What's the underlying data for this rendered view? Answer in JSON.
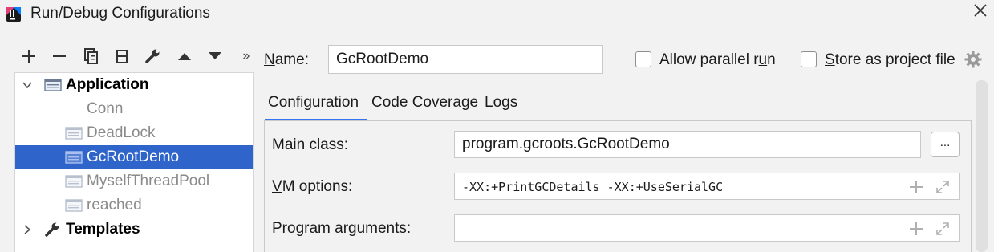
{
  "window": {
    "title": "Run/Debug Configurations"
  },
  "toolbar": {
    "items": [
      "add-icon",
      "remove-icon",
      "copy-icon",
      "save-icon",
      "wrench-icon",
      "move-up-icon",
      "move-down-icon",
      "more-icon"
    ],
    "more_label": "»"
  },
  "tree": {
    "application": {
      "label": "Application",
      "expanded": true
    },
    "children": [
      {
        "label": "Conn"
      },
      {
        "label": "DeadLock"
      },
      {
        "label": "GcRootDemo",
        "selected": true
      },
      {
        "label": "MyselfThreadPool"
      },
      {
        "label": "reached"
      }
    ],
    "templates": {
      "label": "Templates",
      "expanded": false
    }
  },
  "form": {
    "name_label_prefix": "N",
    "name_label_rest": "ame:",
    "name_value": "GcRootDemo",
    "allow_parallel_pre": "Allow parallel r",
    "allow_parallel_u": "u",
    "allow_parallel_post": "n",
    "store_pre": "",
    "store_u": "S",
    "store_post": "tore as project file"
  },
  "tabs": [
    "Configuration",
    "Code Coverage",
    "Logs"
  ],
  "config": {
    "main_class_label": "Main class:",
    "main_class_value": "program.gcroots.GcRootDemo",
    "browse_label": "...",
    "vm_label_u": "V",
    "vm_label_rest": "M options:",
    "vm_value": "-XX:+PrintGCDetails -XX:+UseSerialGC",
    "program_args_label_pre": "Program a",
    "program_args_label_u": "r",
    "program_args_label_post": "guments:",
    "program_args_value": ""
  },
  "colors": {
    "selection": "#2f65ca",
    "accent": "#3574f0"
  }
}
